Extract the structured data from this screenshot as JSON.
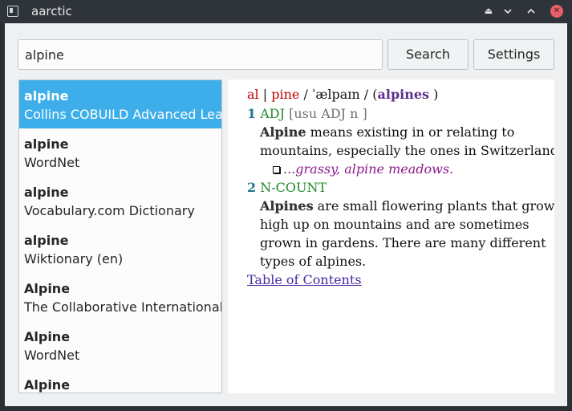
{
  "window": {
    "title": "aarctic"
  },
  "search": {
    "value": "alpine",
    "button_label": "Search",
    "settings_label": "Settings"
  },
  "results": [
    {
      "word": "alpine",
      "dict": "Collins COBUILD Advanced Learner's Dictionary",
      "selected": true
    },
    {
      "word": "alpine",
      "dict": "WordNet",
      "selected": false
    },
    {
      "word": "alpine",
      "dict": "Vocabulary.com Dictionary",
      "selected": false
    },
    {
      "word": "alpine",
      "dict": "Wiktionary (en)",
      "selected": false
    },
    {
      "word": "Alpine",
      "dict": "The Collaborative International Dictionary of English",
      "selected": false
    },
    {
      "word": "Alpine",
      "dict": "WordNet",
      "selected": false
    },
    {
      "word": "Alpine",
      "dict": "",
      "selected": false
    }
  ],
  "article": {
    "syll1": "al",
    "sep1": "|",
    "syll2": "pine",
    "pron": "/ ˈælpaɪn /",
    "plural_open": "(",
    "plural": "alpines",
    "plural_close": ")",
    "senses": [
      {
        "num": "1",
        "pos": "ADJ",
        "gram": "[usu ADJ n ]",
        "headword": "Alpine",
        "def_line1": " means existing in or relating to",
        "def_line2": "mountains, especially the ones in Switzerland.",
        "example": "...grassy, alpine meadows."
      },
      {
        "num": "2",
        "pos": "N-COUNT",
        "headword": "Alpines",
        "def_line1": " are small flowering plants that grow",
        "def_line2": "high up on mountains and are sometimes",
        "def_line3": "grown in gardens. There are many different",
        "def_line4": "types of alpines."
      }
    ],
    "toc_link": "Table of Contents"
  },
  "icons": {
    "app": "app-icon",
    "keep_above": "keep-above-icon",
    "minimize": "minimize-icon",
    "maximize": "maximize-icon",
    "close": "close-icon"
  },
  "colors": {
    "selection": "#3daee9",
    "titlebar": "#2f343b",
    "close": "#e95f68"
  }
}
